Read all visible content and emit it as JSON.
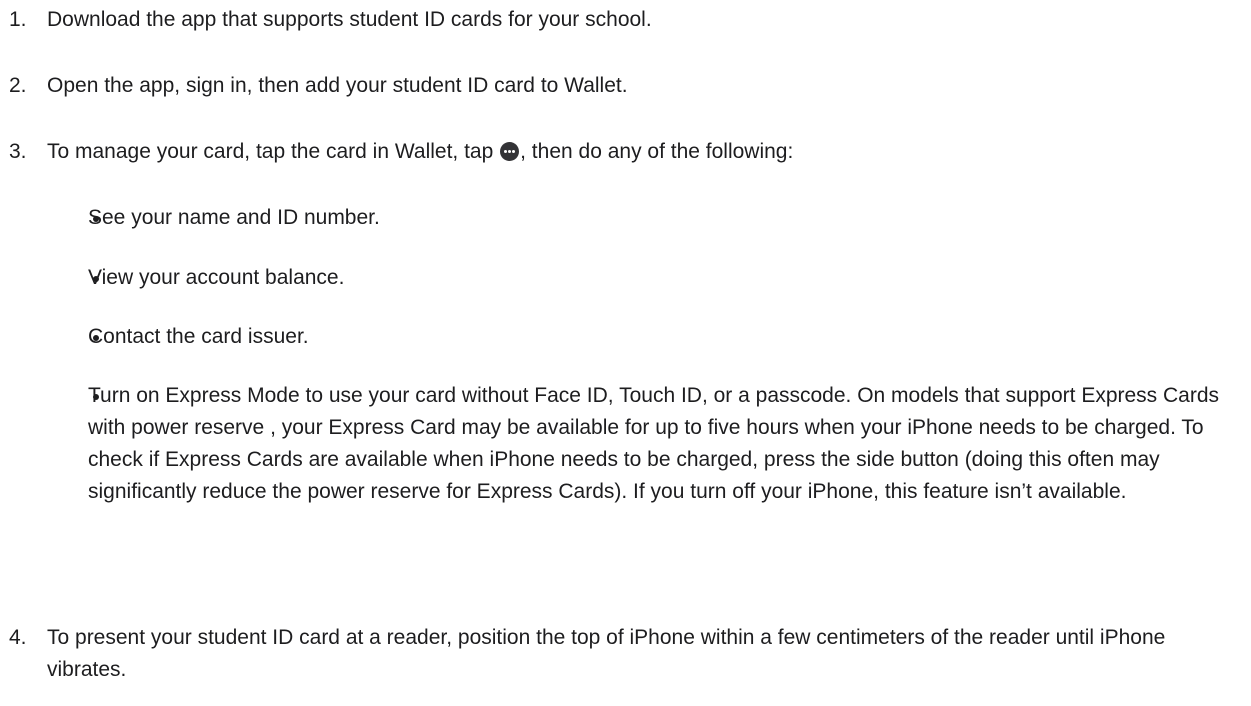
{
  "steps": [
    {
      "num": "1.",
      "text": "Download the app that supports student ID cards for your school."
    },
    {
      "num": "2.",
      "text": "Open the app, sign in, then add your student ID card to Wallet."
    },
    {
      "num": "3.",
      "text_before": "To manage your card, tap the card in Wallet, tap ",
      "text_after": ", then do any of the following:",
      "icon": "more-icon"
    },
    {
      "num": "4.",
      "text": "To present your student ID card at a reader, position the top of iPhone within a few centimeters of the reader until iPhone vibrates."
    }
  ],
  "bullets": [
    "See your name and ID number.",
    "View your account balance.",
    "Contact the card issuer.",
    "Turn on Express Mode to use your card without Face ID, Touch ID, or a passcode. On models that support Express Cards with power reserve , your Express Card may be available for up to five hours when your iPhone needs to be charged. To check if Express Cards are available when iPhone needs to be charged, press the side button (doing this often may significantly reduce the power reserve for Express Cards). If you turn off your iPhone, this feature isn’t available."
  ]
}
